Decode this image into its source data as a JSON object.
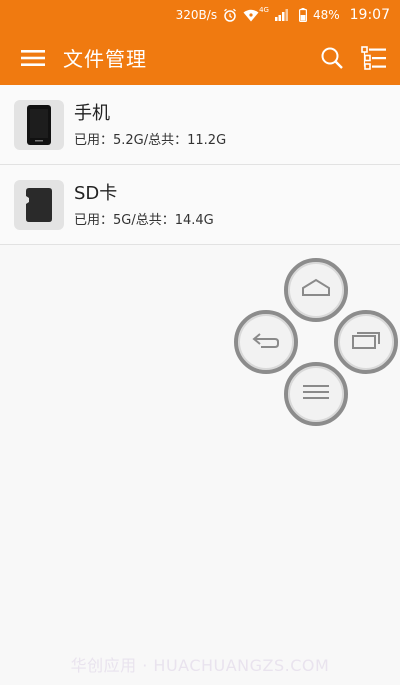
{
  "status_bar": {
    "speed": "320B/s",
    "network": "4G",
    "battery": "48%",
    "time": "19:07",
    "icons": [
      "alarm-icon",
      "wifi-icon",
      "signal-icon",
      "battery-icon"
    ]
  },
  "app_bar": {
    "title": "文件管理",
    "icons": [
      "menu-icon",
      "search-icon",
      "list-view-icon"
    ],
    "color": "#f07a10"
  },
  "storage": [
    {
      "name": "手机",
      "detail": "已用：5.2G/总共：11.2G",
      "icon": "phone-icon"
    },
    {
      "name": "SD卡",
      "detail": "已用：5G/总共：14.4G",
      "icon": "sd-card-icon"
    }
  ],
  "floating_nav": {
    "icons": [
      "home-icon",
      "back-icon",
      "recent-apps-icon",
      "menu-lines-icon"
    ]
  },
  "watermark": "华创应用 · HUACHUANGZS.COM"
}
